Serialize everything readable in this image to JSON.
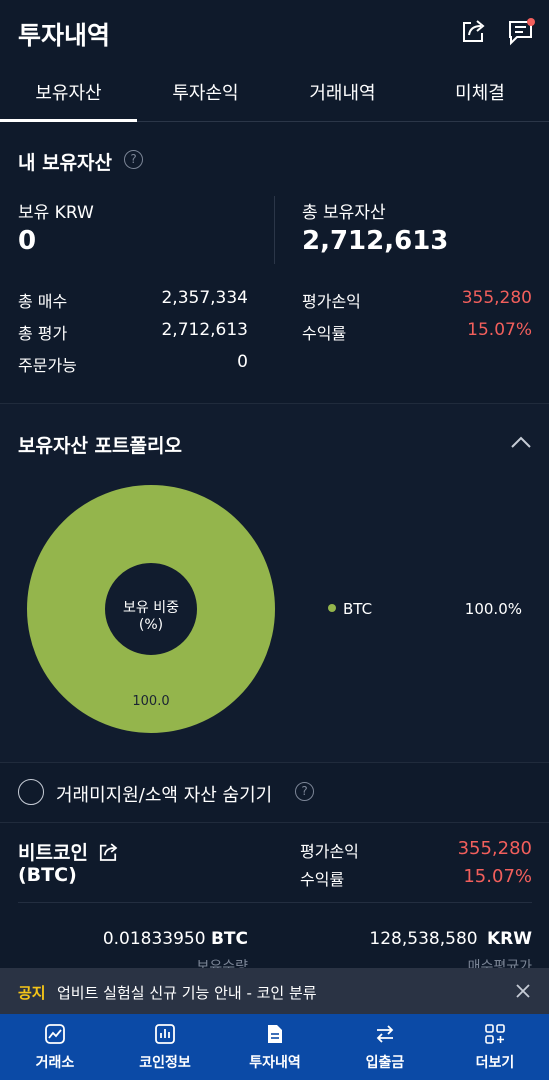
{
  "header": {
    "title": "투자내역",
    "share_icon": "share-icon",
    "notice_icon": "message-icon"
  },
  "tabs": [
    {
      "label": "보유자산",
      "active": true
    },
    {
      "label": "투자손익",
      "active": false
    },
    {
      "label": "거래내역",
      "active": false
    },
    {
      "label": "미체결",
      "active": false
    }
  ],
  "holdings": {
    "title": "내 보유자산",
    "krw_label": "보유 KRW",
    "krw_value": "0",
    "total_label": "총 보유자산",
    "total_value": "2,712,613",
    "rows_left": [
      {
        "label": "총 매수",
        "value": "2,357,334"
      },
      {
        "label": "총 평가",
        "value": "2,712,613"
      },
      {
        "label": "주문가능",
        "value": "0"
      }
    ],
    "rows_right": [
      {
        "label": "평가손익",
        "value": "355,280"
      },
      {
        "label": "수익률",
        "value": "15.07%"
      }
    ]
  },
  "portfolio": {
    "title": "보유자산 포트폴리오",
    "center_label_line1": "보유 비중",
    "center_label_line2": "(%)",
    "legend": [
      {
        "name": "BTC",
        "value": "100.0%",
        "color": "#94b54c"
      }
    ]
  },
  "chart_data": {
    "type": "pie",
    "categories": [
      "BTC"
    ],
    "values": [
      100.0
    ],
    "data_labels": [
      "100.0"
    ],
    "colors": [
      "#94b54c"
    ],
    "donut": true
  },
  "hide_option": {
    "label": "거래미지원/소액 자산 숨기기"
  },
  "coin": {
    "name": "비트코인",
    "symbol": "(BTC)",
    "pnl_label": "평가손익",
    "pnl_value": "355,280",
    "rate_label": "수익률",
    "rate_value": "15.07%",
    "amount": "0.01833950",
    "amount_unit": "BTC",
    "amount_label": "보유수량",
    "avg_price": "128,538,580",
    "avg_unit": "KRW",
    "avg_label": "매수평균가"
  },
  "notice": {
    "tag": "공지",
    "text": "업비트 실험실 신규 기능 안내 - 코인 분류"
  },
  "nav": [
    {
      "label": "거래소",
      "icon": "chart-icon",
      "active": false
    },
    {
      "label": "코인정보",
      "icon": "bar-chart-icon",
      "active": false
    },
    {
      "label": "투자내역",
      "icon": "document-icon",
      "active": true
    },
    {
      "label": "입출금",
      "icon": "transfer-icon",
      "active": false
    },
    {
      "label": "더보기",
      "icon": "more-icon",
      "active": false
    }
  ],
  "colors": {
    "background": "#0f1a2b",
    "accent_red": "#f25f5c",
    "nav_bg": "#0b4aa6",
    "notice_tag": "#f5c518"
  }
}
